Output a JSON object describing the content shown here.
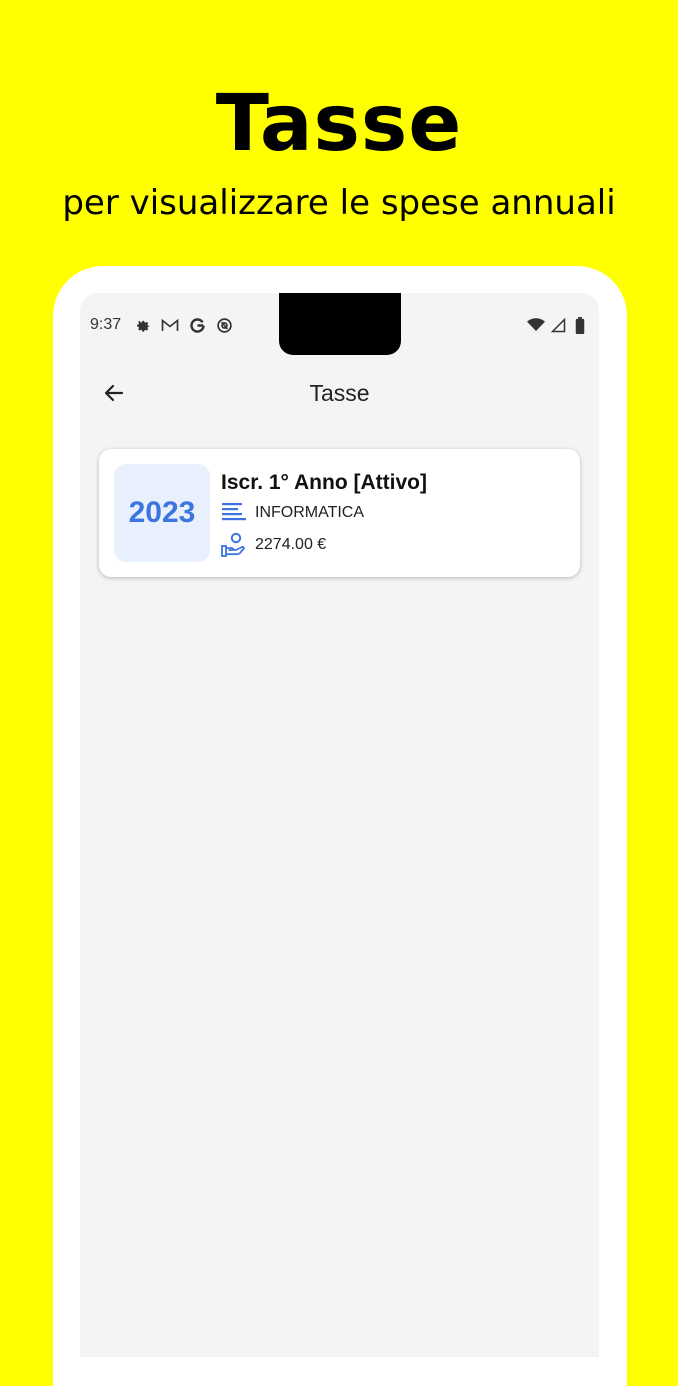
{
  "promo": {
    "title": "Tasse",
    "subtitle": "per visualizzare le spese annuali"
  },
  "colors": {
    "background": "#ffff00",
    "accent": "#3c74e0",
    "year_box_bg": "#e8f0fd"
  },
  "status_bar": {
    "time": "9:37",
    "left_icons": [
      "gear-icon",
      "gmail-icon",
      "google-icon",
      "at-sign-icon"
    ],
    "right_icons": [
      "wifi-icon",
      "signal-icon",
      "battery-icon"
    ]
  },
  "app_bar": {
    "title": "Tasse",
    "back_icon": "arrow-left-icon"
  },
  "fees": [
    {
      "year": "2023",
      "title": "Iscr. 1° Anno [Attivo]",
      "course": "INFORMATICA",
      "course_icon": "text-lines-icon",
      "amount": "2274.00 €",
      "amount_icon": "hand-coin-icon"
    }
  ]
}
